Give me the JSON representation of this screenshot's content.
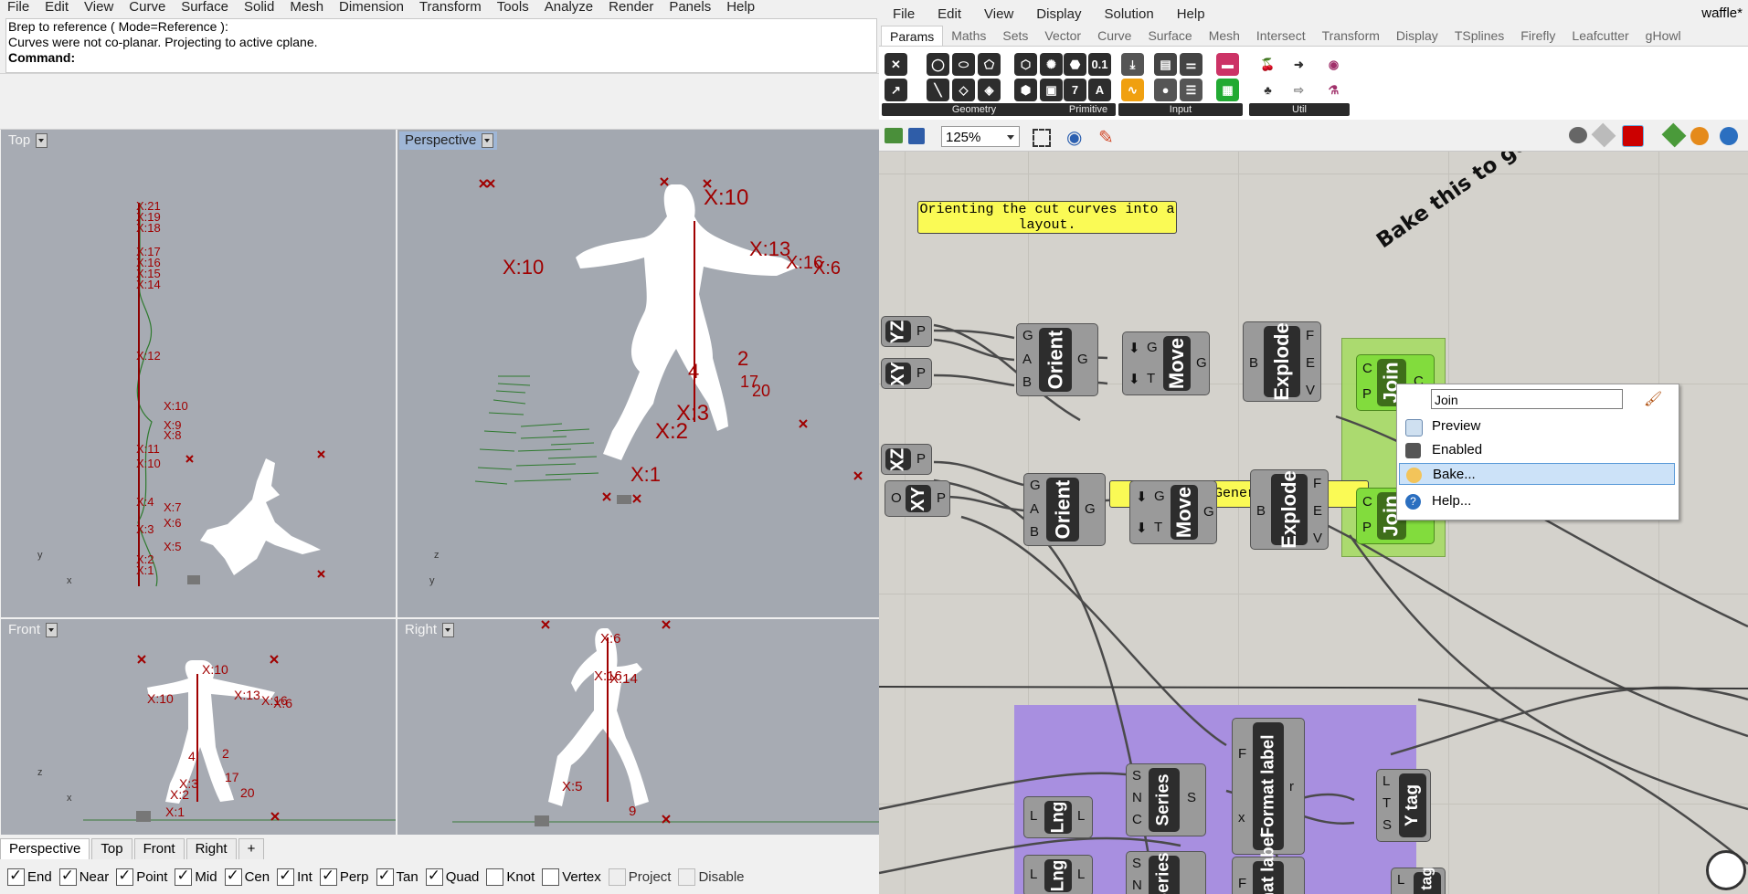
{
  "rhino": {
    "menu": [
      "File",
      "Edit",
      "View",
      "Curve",
      "Surface",
      "Solid",
      "Mesh",
      "Dimension",
      "Transform",
      "Tools",
      "Analyze",
      "Render",
      "Panels",
      "Help"
    ],
    "command_history": [
      "Brep to reference ( Mode=Reference ):",
      "Curves were not co-planar. Projecting to active cplane."
    ],
    "command_label": "Command:",
    "viewports": {
      "top": {
        "label": "Top",
        "axis_a": "y",
        "axis_b": "x"
      },
      "perspective": {
        "label": "Perspective",
        "axis_a": "z",
        "axis_b": "y"
      },
      "front": {
        "label": "Front",
        "axis_a": "z",
        "axis_b": "x"
      },
      "right": {
        "label": "Right",
        "axis_a": "z",
        "axis_b": "y"
      }
    },
    "viewport_tabs": [
      "Perspective",
      "Top",
      "Front",
      "Right"
    ],
    "viewport_tab_add": "+",
    "osnaps": [
      {
        "label": "End",
        "checked": true
      },
      {
        "label": "Near",
        "checked": true
      },
      {
        "label": "Point",
        "checked": true
      },
      {
        "label": "Mid",
        "checked": true
      },
      {
        "label": "Cen",
        "checked": true
      },
      {
        "label": "Int",
        "checked": true
      },
      {
        "label": "Perp",
        "checked": true
      },
      {
        "label": "Tan",
        "checked": true
      },
      {
        "label": "Quad",
        "checked": true
      },
      {
        "label": "Knot",
        "checked": false
      },
      {
        "label": "Vertex",
        "checked": false
      },
      {
        "label": "Project",
        "checked": false,
        "disabled": true
      },
      {
        "label": "Disable",
        "checked": false,
        "disabled": true
      }
    ],
    "figure_labels": {
      "top_labels": [
        "X:21",
        "X:19",
        "X:18",
        "X:17",
        "X:16",
        "X:15",
        "X:14",
        "X:12",
        "X:10",
        "X:9",
        "X:8",
        "X:11",
        "X:10",
        "X:4",
        "X:3",
        "X:7",
        "X:6",
        "X:5",
        "X:2",
        "X:1"
      ],
      "persp_labels": [
        "X:10",
        "X:13",
        "X:16",
        "X:6",
        "4",
        "2",
        "X:3",
        "X:2",
        "X:1",
        "17",
        "20"
      ],
      "front_labels": [
        "X:10",
        "X:13",
        "X:16",
        "X:6",
        "4",
        "2",
        "X:3",
        "X:2",
        "X:1",
        "17",
        "20"
      ],
      "right_labels": [
        "X:6",
        "X:16",
        "X:14",
        "X:5",
        "9"
      ]
    }
  },
  "gh": {
    "menu": [
      "File",
      "Edit",
      "View",
      "Display",
      "Solution",
      "Help"
    ],
    "title": "waffle*",
    "tabs": [
      "Params",
      "Maths",
      "Sets",
      "Vector",
      "Curve",
      "Surface",
      "Mesh",
      "Intersect",
      "Transform",
      "Display",
      "TSplines",
      "Firefly",
      "Leafcutter",
      "gHowl"
    ],
    "active_tab": "Params",
    "panels": [
      {
        "label": "Geometry"
      },
      {
        "label": "Primitive"
      },
      {
        "label": "Input"
      },
      {
        "label": "Util"
      }
    ],
    "zoom": "125%",
    "canvas": {
      "scribble_1": "Orienting the cut curves into a layout.",
      "scribble_2": "Tag Generation",
      "bake_note": "Bake this to get the",
      "components": {
        "yz": "YZ",
        "xy1": "XY",
        "xz": "XZ",
        "xy2": "XY",
        "orient": "Orient",
        "move": "Move",
        "explode": "Explode",
        "join": "Join",
        "lng": "Lng",
        "series": "Series",
        "format": "Format label",
        "ytag": "Y tag"
      },
      "ports": {
        "p": "P",
        "o": "O",
        "g": "G",
        "a": "A",
        "b": "B",
        "t": "T",
        "f": "F",
        "e": "E",
        "v": "V",
        "c": "C",
        "s": "S",
        "n": "N",
        "l": "L",
        "x": "x",
        "r": "r"
      }
    },
    "context_menu": {
      "name_value": "Join",
      "items": [
        {
          "label": "Preview",
          "highlighted": false
        },
        {
          "label": "Enabled",
          "highlighted": false
        },
        {
          "label": "Bake...",
          "highlighted": true
        },
        {
          "label": "Help...",
          "highlighted": false
        }
      ]
    }
  }
}
